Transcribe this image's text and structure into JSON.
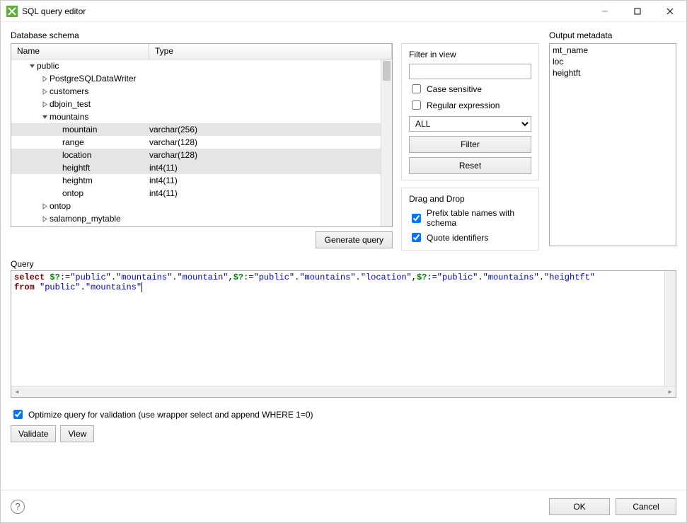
{
  "window": {
    "title": "SQL query editor"
  },
  "schema": {
    "group_label": "Database schema",
    "columns": {
      "name": "Name",
      "type": "Type"
    },
    "rows": [
      {
        "depth": 1,
        "caret": "down",
        "name": "public",
        "type": "",
        "sel": false
      },
      {
        "depth": 2,
        "caret": "right",
        "name": "PostgreSQLDataWriter",
        "type": "",
        "sel": false
      },
      {
        "depth": 2,
        "caret": "right",
        "name": "customers",
        "type": "",
        "sel": false
      },
      {
        "depth": 2,
        "caret": "right",
        "name": "dbjoin_test",
        "type": "",
        "sel": false
      },
      {
        "depth": 2,
        "caret": "down",
        "name": "mountains",
        "type": "",
        "sel": false
      },
      {
        "depth": 3,
        "caret": "",
        "name": "mountain",
        "type": "varchar(256)",
        "sel": true
      },
      {
        "depth": 3,
        "caret": "",
        "name": "range",
        "type": "varchar(128)",
        "sel": false
      },
      {
        "depth": 3,
        "caret": "",
        "name": "location",
        "type": "varchar(128)",
        "sel": true
      },
      {
        "depth": 3,
        "caret": "",
        "name": "heightft",
        "type": "int4(11)",
        "sel": true
      },
      {
        "depth": 3,
        "caret": "",
        "name": "heightm",
        "type": "int4(11)",
        "sel": false
      },
      {
        "depth": 3,
        "caret": "",
        "name": "ontop",
        "type": "int4(11)",
        "sel": false
      },
      {
        "depth": 2,
        "caret": "right",
        "name": "ontop",
        "type": "",
        "sel": false
      },
      {
        "depth": 2,
        "caret": "right",
        "name": "salamonp_mytable",
        "type": "",
        "sel": false
      }
    ],
    "filter_box": {
      "title": "Filter in view",
      "value": "",
      "case_sensitive_label": "Case sensitive",
      "case_sensitive": false,
      "regex_label": "Regular expression",
      "regex": false,
      "scope_value": "ALL",
      "filter_btn": "Filter",
      "reset_btn": "Reset"
    },
    "drag_box": {
      "title": "Drag and Drop",
      "prefix_label": "Prefix table names with schema",
      "prefix": true,
      "quote_label": "Quote identifiers",
      "quote": true
    },
    "generate_btn": "Generate query"
  },
  "output": {
    "group_label": "Output metadata",
    "items": [
      "mt_name",
      "loc",
      "heightft"
    ]
  },
  "query": {
    "label": "Query",
    "tokens_line1": [
      {
        "c": "k",
        "t": "select"
      },
      {
        "c": "op",
        "t": " "
      },
      {
        "c": "p",
        "t": "$?"
      },
      {
        "c": "op",
        "t": ":="
      },
      {
        "c": "s",
        "t": "\"public\""
      },
      {
        "c": "op",
        "t": "."
      },
      {
        "c": "s",
        "t": "\"mountains\""
      },
      {
        "c": "op",
        "t": "."
      },
      {
        "c": "s",
        "t": "\"mountain\""
      },
      {
        "c": "op",
        "t": ","
      },
      {
        "c": "p",
        "t": "$?"
      },
      {
        "c": "op",
        "t": ":="
      },
      {
        "c": "s",
        "t": "\"public\""
      },
      {
        "c": "op",
        "t": "."
      },
      {
        "c": "s",
        "t": "\"mountains\""
      },
      {
        "c": "op",
        "t": "."
      },
      {
        "c": "s",
        "t": "\"location\""
      },
      {
        "c": "op",
        "t": ","
      },
      {
        "c": "p",
        "t": "$?"
      },
      {
        "c": "op",
        "t": ":="
      },
      {
        "c": "s",
        "t": "\"public\""
      },
      {
        "c": "op",
        "t": "."
      },
      {
        "c": "s",
        "t": "\"mountains\""
      },
      {
        "c": "op",
        "t": "."
      },
      {
        "c": "s",
        "t": "\"heightft\""
      }
    ],
    "tokens_line2": [
      {
        "c": "k",
        "t": "from"
      },
      {
        "c": "op",
        "t": " "
      },
      {
        "c": "s",
        "t": "\"public\""
      },
      {
        "c": "op",
        "t": "."
      },
      {
        "c": "s",
        "t": "\"mountains\""
      }
    ],
    "optimize_label": "Optimize query for validation (use wrapper select and append WHERE 1=0)",
    "optimize": true,
    "validate_btn": "Validate",
    "view_btn": "View"
  },
  "footer": {
    "ok": "OK",
    "cancel": "Cancel"
  }
}
